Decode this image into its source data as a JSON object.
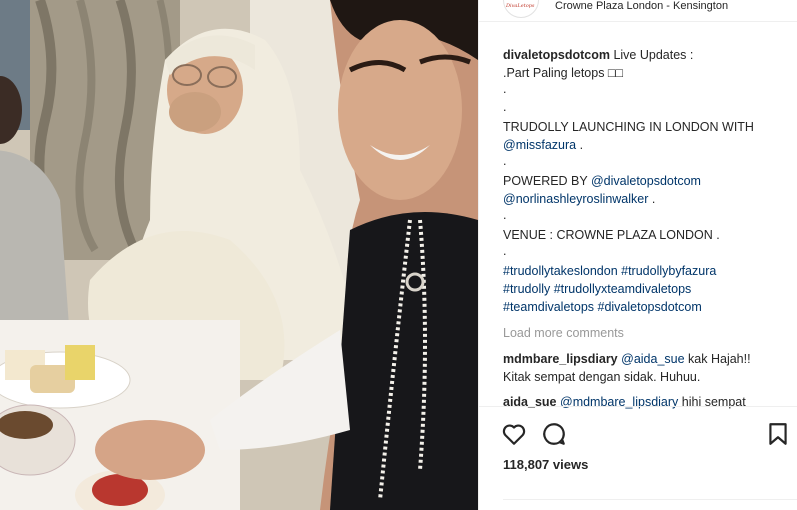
{
  "post": {
    "location": "Crowne Plaza London - Kensington",
    "avatar_text": "DivaLetops",
    "caption": {
      "username": "divaletopsdotcom",
      "line1_text": " Live Updates :",
      "line2": ".Part Paling letops □□",
      "dot": ".",
      "line5": "TRUDOLLY LAUNCHING IN LONDON WITH",
      "mention_fazura": "@missfazura",
      "line6_suffix": " .",
      "line8_prefix": "POWERED BY ",
      "mention_divaletops": "@divaletopsdotcom",
      "mention_norlin": "@norlinashleyroslinwalker",
      "line9_suffix": " .",
      "line11": "VENUE : CROWNE PLAZA LONDON .",
      "tags_line1": "#trudollytakeslondon #trudollybyfazura",
      "tags_line2": "#trudolly #trudollyxteamdivaletops",
      "tags_line3": "#teamdivaletops #divaletopsdotcom"
    },
    "load_more": "Load more comments",
    "comments": [
      {
        "username": "mdmbare_lipsdiary",
        "mention": "@aida_sue",
        "text": " kak Hajah!!",
        "text2": "Kitak sempat dengan sidak. Huhuu."
      },
      {
        "username": "aida_sue",
        "mention": "@mdmbare_lipsdiary",
        "text": " hihi sempat"
      }
    ],
    "views": "118,807 views"
  },
  "icons": {
    "like": "heart-icon",
    "comment": "comment-icon",
    "save": "bookmark-icon"
  },
  "colors": {
    "link": "#003569",
    "muted": "#999999",
    "text": "#262626",
    "border": "#efefef"
  }
}
